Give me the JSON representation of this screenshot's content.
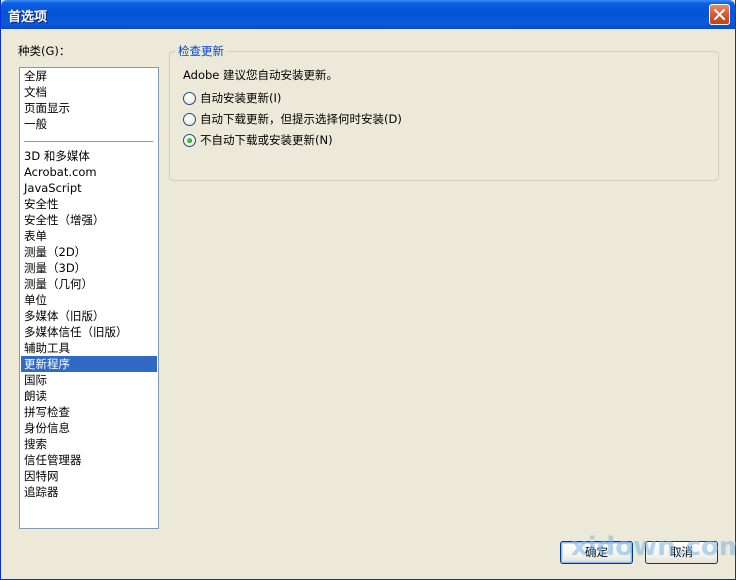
{
  "window": {
    "title": "首选项"
  },
  "categories": {
    "label": "种类(G)：",
    "group1": [
      "全屏",
      "文档",
      "页面显示",
      "一般"
    ],
    "group2": [
      "3D 和多媒体",
      "Acrobat.com",
      "JavaScript",
      "安全性",
      "安全性（增强）",
      "表单",
      "测量（2D）",
      "测量（3D）",
      "测量（几何）",
      "单位",
      "多媒体（旧版）",
      "多媒体信任（旧版）",
      "辅助工具",
      "更新程序",
      "国际",
      "朗读",
      "拼写检查",
      "身份信息",
      "搜索",
      "信任管理器",
      "因特网",
      "追踪器"
    ],
    "selected": "更新程序"
  },
  "update_group": {
    "legend": "检查更新",
    "description": "Adobe 建议您自动安装更新。",
    "options": [
      "自动安装更新(I)",
      "自动下载更新，但提示选择何时安装(D)",
      "不自动下载或安装更新(N)"
    ],
    "selected_index": 2
  },
  "buttons": {
    "ok": "确定",
    "cancel": "取消"
  },
  "watermark": "xidown.com",
  "colors": {
    "titlebar": "#0553d6",
    "selection": "#316ac5",
    "legend": "#0046d5"
  }
}
